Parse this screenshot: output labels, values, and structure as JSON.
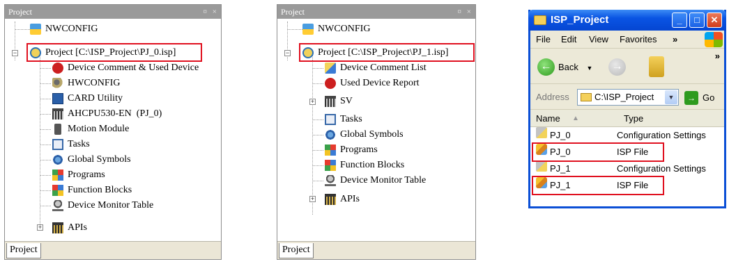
{
  "panel1": {
    "title": "Project",
    "pin": "¤",
    "close": "×",
    "items": [
      {
        "label": "NWCONFIG",
        "icon": "nwconfig-icon"
      },
      {
        "label": "Project [C:\\ISP_Project\\PJ_0.isp]",
        "icon": "project-icon"
      },
      {
        "label": "Device Comment & Used Device",
        "icon": "device-comment-icon"
      },
      {
        "label": "HWCONFIG",
        "icon": "hwconfig-icon"
      },
      {
        "label": "CARD Utility",
        "icon": "card-utility-icon"
      },
      {
        "label": "AHCPU530-EN  (PJ_0)",
        "icon": "cpu-icon"
      },
      {
        "label": "Motion Module",
        "icon": "motion-module-icon"
      },
      {
        "label": "Tasks",
        "icon": "tasks-icon"
      },
      {
        "label": "Global Symbols",
        "icon": "global-symbols-icon"
      },
      {
        "label": "Programs",
        "icon": "programs-icon"
      },
      {
        "label": "Function Blocks",
        "icon": "function-blocks-icon"
      },
      {
        "label": "Device Monitor Table",
        "icon": "device-monitor-icon"
      },
      {
        "label": "APIs",
        "icon": "apis-icon"
      }
    ],
    "tab": "Project"
  },
  "panel2": {
    "title": "Project",
    "pin": "¤",
    "close": "×",
    "items": [
      {
        "label": "NWCONFIG",
        "icon": "nwconfig-icon"
      },
      {
        "label": "Project [C:\\ISP_Project\\PJ_1.isp]",
        "icon": "project-icon"
      },
      {
        "label": "Device Comment List",
        "icon": "device-comment-list-icon"
      },
      {
        "label": "Used Device Report",
        "icon": "used-device-report-icon"
      },
      {
        "label": "SV",
        "icon": "sv-icon"
      },
      {
        "label": "Tasks",
        "icon": "tasks-icon"
      },
      {
        "label": "Global Symbols",
        "icon": "global-symbols-icon"
      },
      {
        "label": "Programs",
        "icon": "programs-icon"
      },
      {
        "label": "Function Blocks",
        "icon": "function-blocks-icon"
      },
      {
        "label": "Device Monitor Table",
        "icon": "device-monitor-icon"
      },
      {
        "label": "APIs",
        "icon": "apis-icon"
      }
    ],
    "tab": "Project"
  },
  "explorer": {
    "title": "ISP_Project",
    "min": "_",
    "max": "□",
    "close": "✕",
    "menu": [
      "File",
      "Edit",
      "View",
      "Favorites",
      "»"
    ],
    "back_label": "Back",
    "back_arrow": "←",
    "fwd_arrow": "→",
    "address_label": "Address",
    "address_value": "C:\\ISP_Project",
    "go_label": "Go",
    "go_arrow": "→",
    "columns": {
      "name": "Name",
      "type": "Type"
    },
    "files": [
      {
        "name": "PJ_0",
        "type": "Configuration Settings",
        "icon": "config-file-icon"
      },
      {
        "name": "PJ_0",
        "type": "ISP File",
        "icon": "isp-file-icon"
      },
      {
        "name": "PJ_1",
        "type": "Configuration Settings",
        "icon": "config-file-icon"
      },
      {
        "name": "PJ_1",
        "type": "ISP File",
        "icon": "isp-file-icon"
      }
    ]
  },
  "colors": {
    "highlight": "#e0101f",
    "xp_title": "#0a54e3"
  }
}
